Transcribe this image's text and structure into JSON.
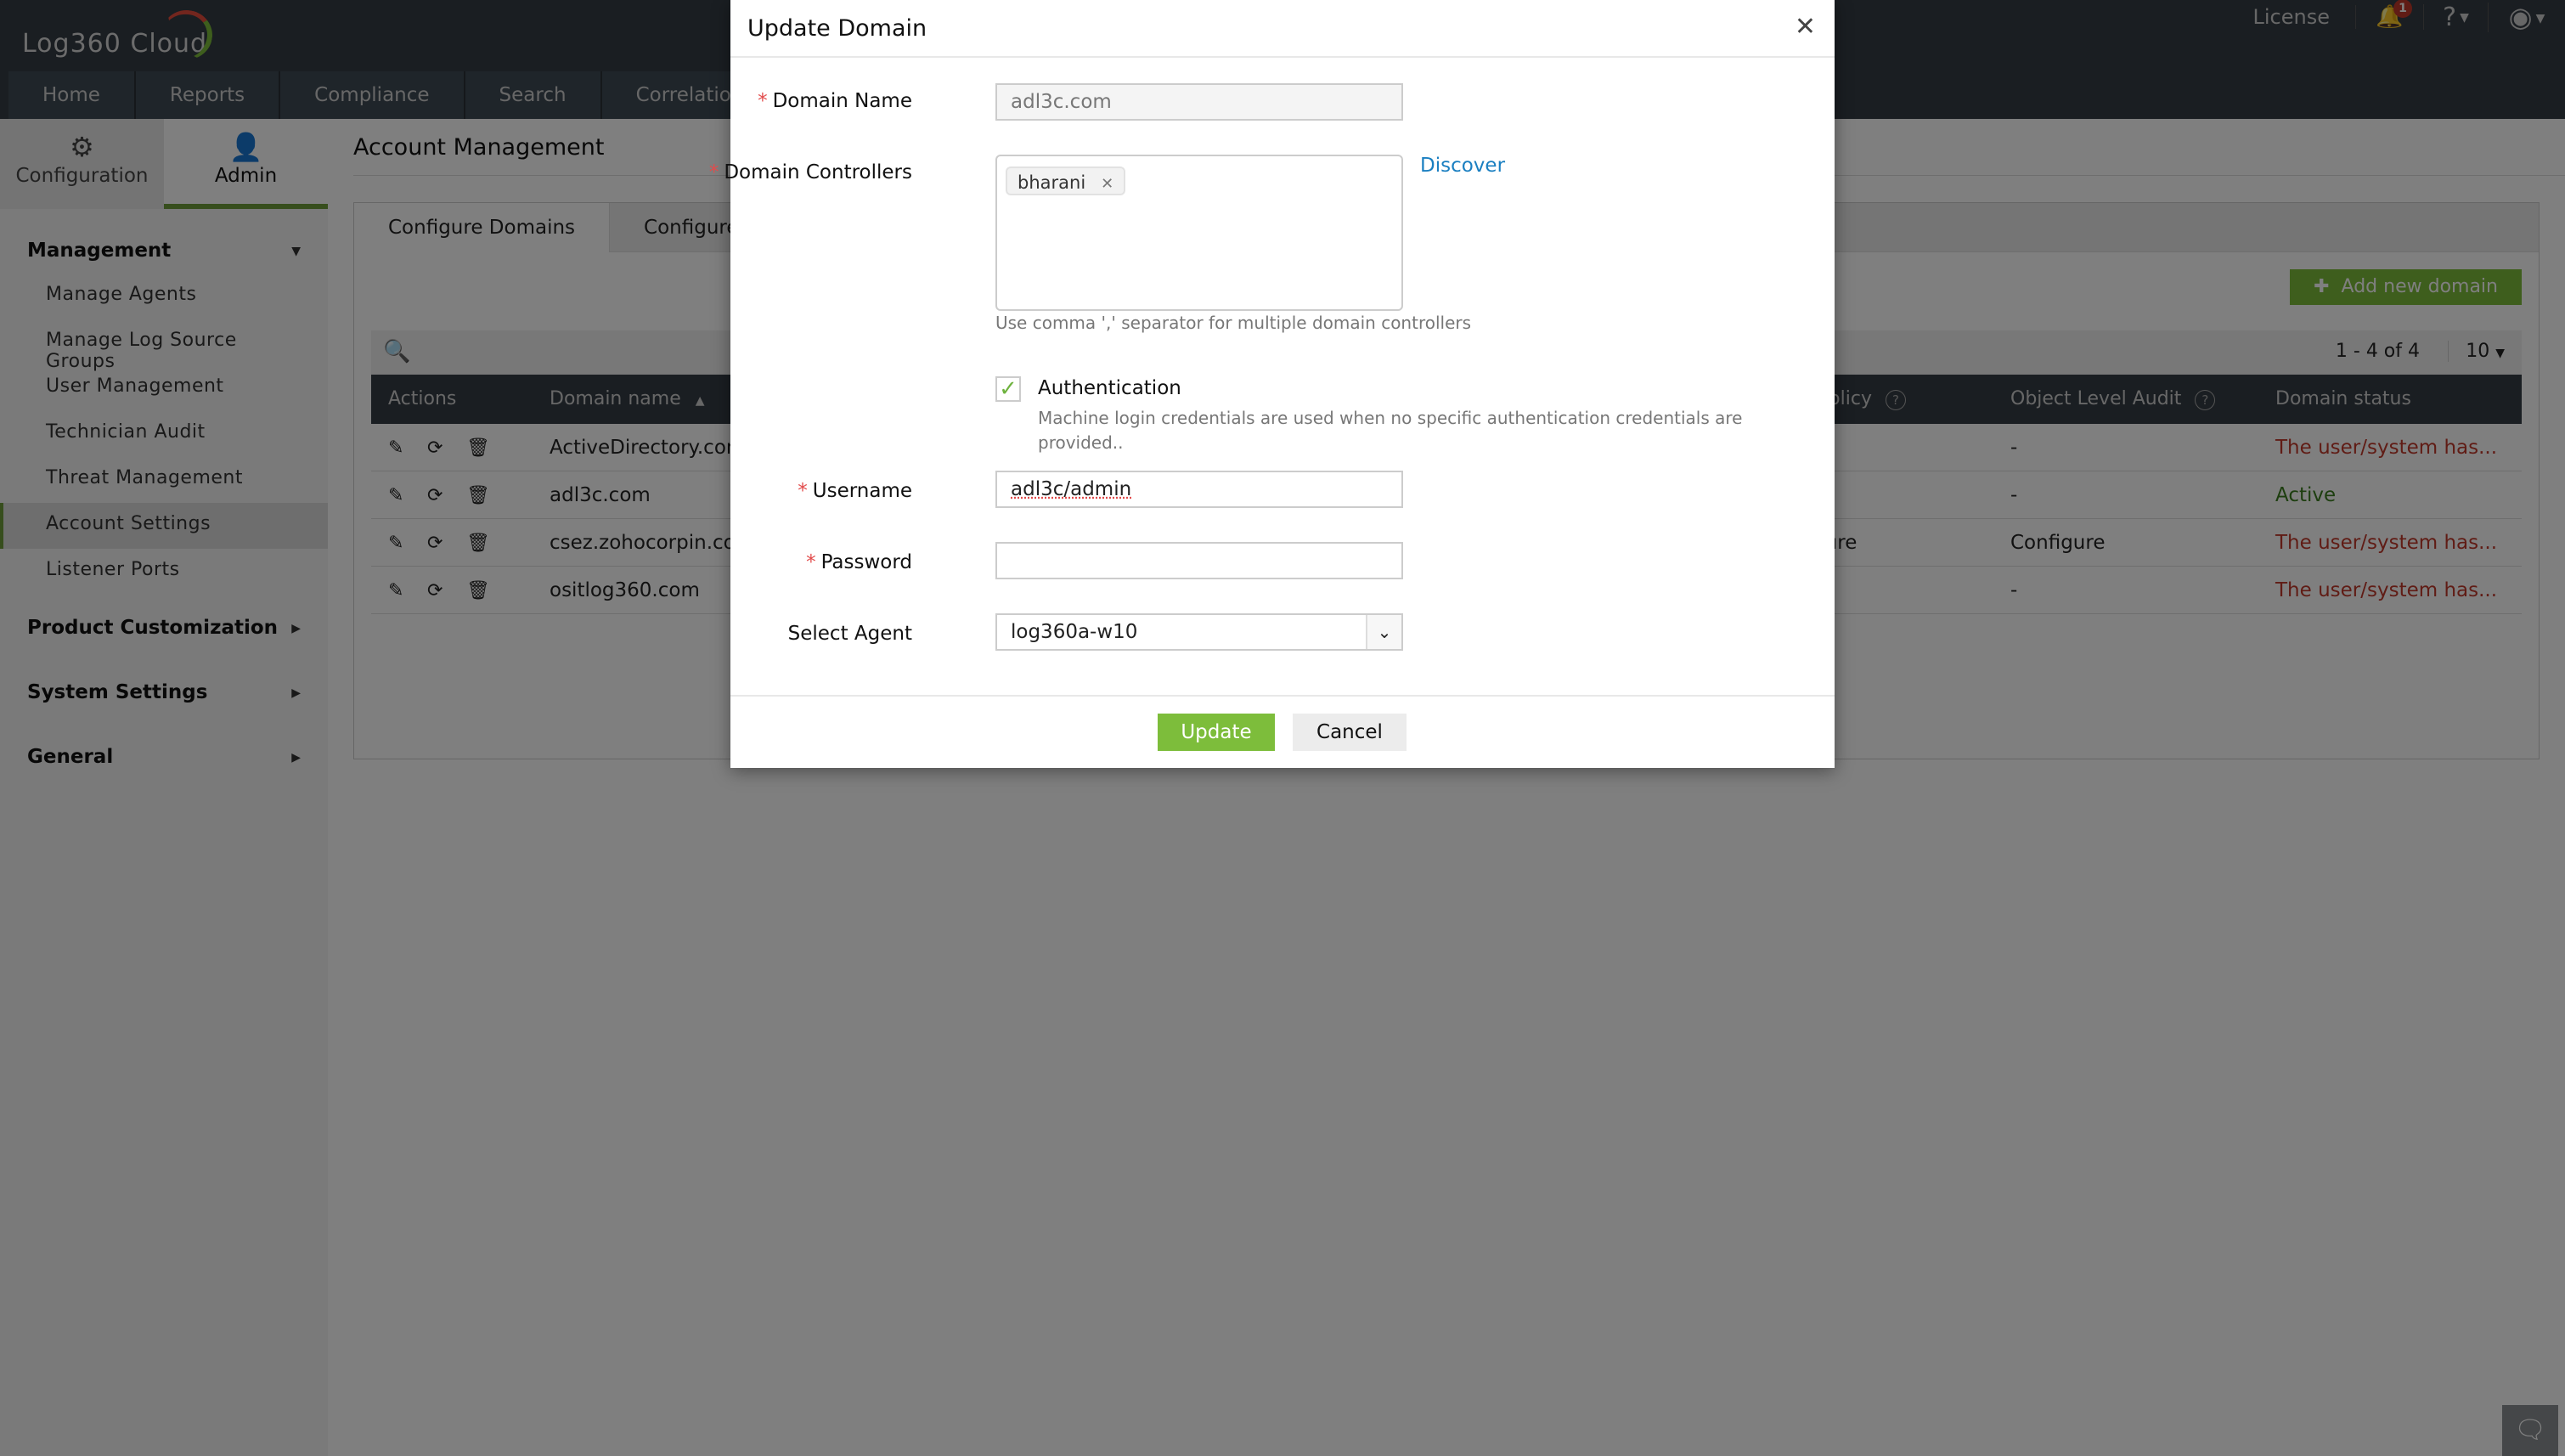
{
  "app": {
    "brand": "Log360 Cloud",
    "license_label": "License",
    "notification_count": "1",
    "help_icon": "?",
    "nav": [
      "Home",
      "Reports",
      "Compliance",
      "Search",
      "Correlation"
    ]
  },
  "modes": [
    {
      "label": "Configuration",
      "icon": "gear-icon",
      "active": false
    },
    {
      "label": "Admin",
      "icon": "admin-user-icon",
      "active": true
    }
  ],
  "sidebar": {
    "groups": [
      {
        "label": "Management",
        "expanded": true,
        "items": [
          "Manage Agents",
          "Manage Log Source Groups",
          "User Management",
          "Technician Audit",
          "Threat Management",
          "Account Settings",
          "Listener Ports"
        ],
        "active_item": "Account Settings"
      },
      {
        "label": "Product Customization",
        "expanded": false
      },
      {
        "label": "System Settings",
        "expanded": false
      },
      {
        "label": "General",
        "expanded": false
      }
    ]
  },
  "page": {
    "title": "Account Management",
    "tabs": [
      "Configure Domains",
      "Configure"
    ],
    "add_button": "Add new domain",
    "pagination": "1 - 4 of 4",
    "per_page": "10",
    "columns": {
      "actions": "Actions",
      "domain": "Domain name",
      "audit_policy": "dit Policy",
      "object_audit": "Object Level Audit",
      "status": "Domain status"
    },
    "rows": [
      {
        "domain": "ActiveDirectory.com",
        "audit_policy": "",
        "object_audit": "-",
        "status": "The user/system has...",
        "status_type": "error"
      },
      {
        "domain": "adl3c.com",
        "audit_policy": "",
        "object_audit": "-",
        "status": "Active",
        "status_type": "ok"
      },
      {
        "domain": "csez.zohocorpin.com",
        "audit_policy": "nfigure",
        "object_audit": "Configure",
        "status": "The user/system has...",
        "status_type": "error"
      },
      {
        "domain": "ositlog360.com",
        "audit_policy": "",
        "object_audit": "-",
        "status": "The user/system has...",
        "status_type": "error"
      }
    ]
  },
  "dialog": {
    "title": "Update Domain",
    "domain_name_label": "Domain Name",
    "domain_name_value": "adl3c.com",
    "dc_label": "Domain Controllers",
    "dc_chips": [
      "bharani"
    ],
    "discover_link": "Discover",
    "dc_hint": "Use comma ',' separator for multiple domain controllers",
    "auth_label": "Authentication",
    "auth_checked": true,
    "auth_desc": "Machine login credentials are used when no specific authentication credentials are provided..",
    "username_label": "Username",
    "username_value": "adl3c/admin",
    "password_label": "Password",
    "password_value": "",
    "agent_label": "Select Agent",
    "agent_value": "log360a-w10",
    "update_button": "Update",
    "cancel_button": "Cancel"
  },
  "colors": {
    "accent_green": "#7dbd3b",
    "error_red": "#c0392b",
    "link_blue": "#1a7fc1",
    "topbar": "#343c44"
  }
}
